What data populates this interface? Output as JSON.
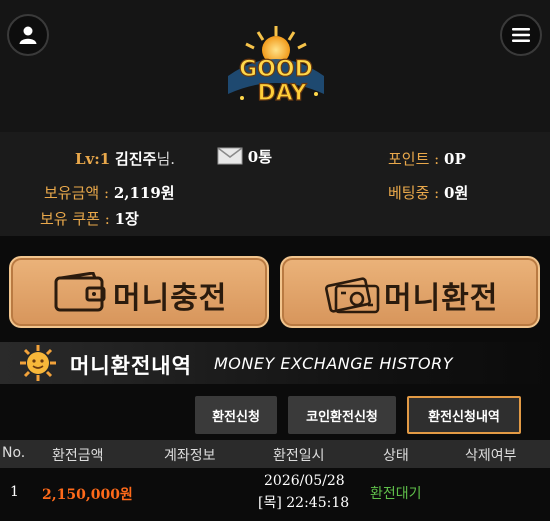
{
  "user": {
    "level": "Lv:1",
    "name": "김진주",
    "suffix": "님.",
    "mail_count": "0통"
  },
  "info": {
    "points_label": "포인트 :",
    "points_value": "0P",
    "balance_label": "보유금액 :",
    "balance_value": "2,119원",
    "betting_label": "베팅중 :",
    "betting_value": "0원",
    "coupon_label": "보유 쿠폰 :",
    "coupon_value": "1장"
  },
  "buttons": {
    "charge": "머니충전",
    "exchange": "머니환전"
  },
  "section": {
    "title_ko": "머니환전내역",
    "title_en": "MONEY EXCHANGE HISTORY"
  },
  "tabs": [
    {
      "label": "환전신청"
    },
    {
      "label": "코인환전신청"
    },
    {
      "label": "환전신청내역"
    }
  ],
  "table": {
    "headers": [
      "No.",
      "환전금액",
      "계좌정보",
      "환전일시",
      "상태",
      "삭제여부"
    ],
    "rows": [
      {
        "no": "1",
        "amount": "2,150,000원",
        "account": "",
        "date": "2026/05/28",
        "time": "[목] 22:45:18",
        "status": "환전대기",
        "delete": ""
      }
    ]
  },
  "colors": {
    "accent": "#e9a84b",
    "amount": "#ff6a1a",
    "status": "#5fbf4a",
    "button": "#e2a46a"
  }
}
